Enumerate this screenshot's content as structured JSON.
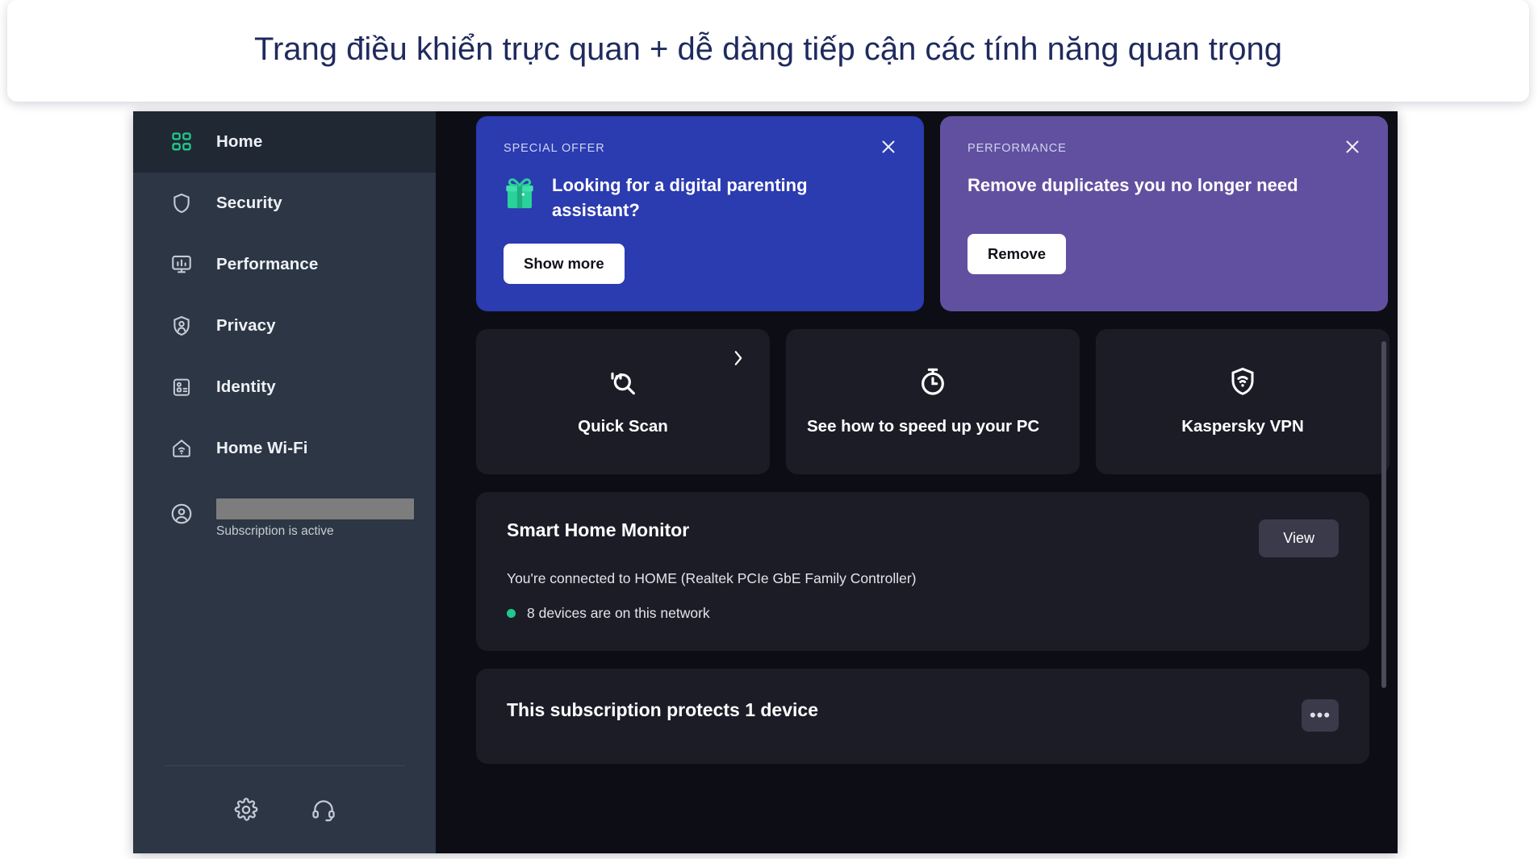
{
  "caption": {
    "text": "Trang điều khiển trực quan + dễ dàng tiếp cận các tính năng quan trọng"
  },
  "colors": {
    "accent_green": "#23c98a",
    "sidebar_bg": "#2c3644",
    "sidebar_active": "#202834",
    "content_bg": "#0d0d15",
    "card_bg": "#1c1c27",
    "promo_blue": "#2b3bb0",
    "promo_purple": "#61509f",
    "promo_cut_teal": "#1a66a3",
    "status_dot": "#1fc98d",
    "caption_text": "#1f2a5e"
  },
  "sidebar": {
    "items": [
      {
        "label": "Home",
        "icon": "home-grid-icon",
        "active": true
      },
      {
        "label": "Security",
        "icon": "shield-icon",
        "active": false
      },
      {
        "label": "Performance",
        "icon": "monitor-icon",
        "active": false
      },
      {
        "label": "Privacy",
        "icon": "privacy-icon",
        "active": false
      },
      {
        "label": "Identity",
        "icon": "id-card-icon",
        "active": false
      },
      {
        "label": "Home Wi-Fi",
        "icon": "home-wifi-icon",
        "active": false
      }
    ],
    "account": {
      "icon": "account-circle-icon",
      "name_redacted": "",
      "status": "Subscription is active"
    },
    "footer": {
      "settings_icon": "gear-icon",
      "support_icon": "headset-icon"
    }
  },
  "promos": [
    {
      "kicker": "SPECIAL OFFER",
      "title": "Looking for a digital parenting assistant?",
      "cta": "Show more",
      "icon": "gift-icon",
      "close_icon": "close-icon",
      "variant": "blue"
    },
    {
      "kicker": "PERFORMANCE",
      "title": "Remove duplicates you no longer need",
      "cta": "Remove",
      "close_icon": "close-icon",
      "variant": "purple"
    }
  ],
  "tiles": [
    {
      "label": "Quick Scan",
      "icon": "scan-search-icon",
      "chevron": "chevron-right-icon"
    },
    {
      "label": "See how to speed up your PC",
      "icon": "stopwatch-icon",
      "chevron": ""
    },
    {
      "label": "Kaspersky VPN",
      "icon": "shield-wifi-icon",
      "chevron": ""
    }
  ],
  "smart_home": {
    "title": "Smart Home Monitor",
    "view_label": "View",
    "subtitle": "You're connected to HOME (Realtek PCIe GbE Family Controller)",
    "status": "8 devices are on this network"
  },
  "subscription": {
    "title": "This subscription protects 1 device",
    "more_label": "•••"
  }
}
